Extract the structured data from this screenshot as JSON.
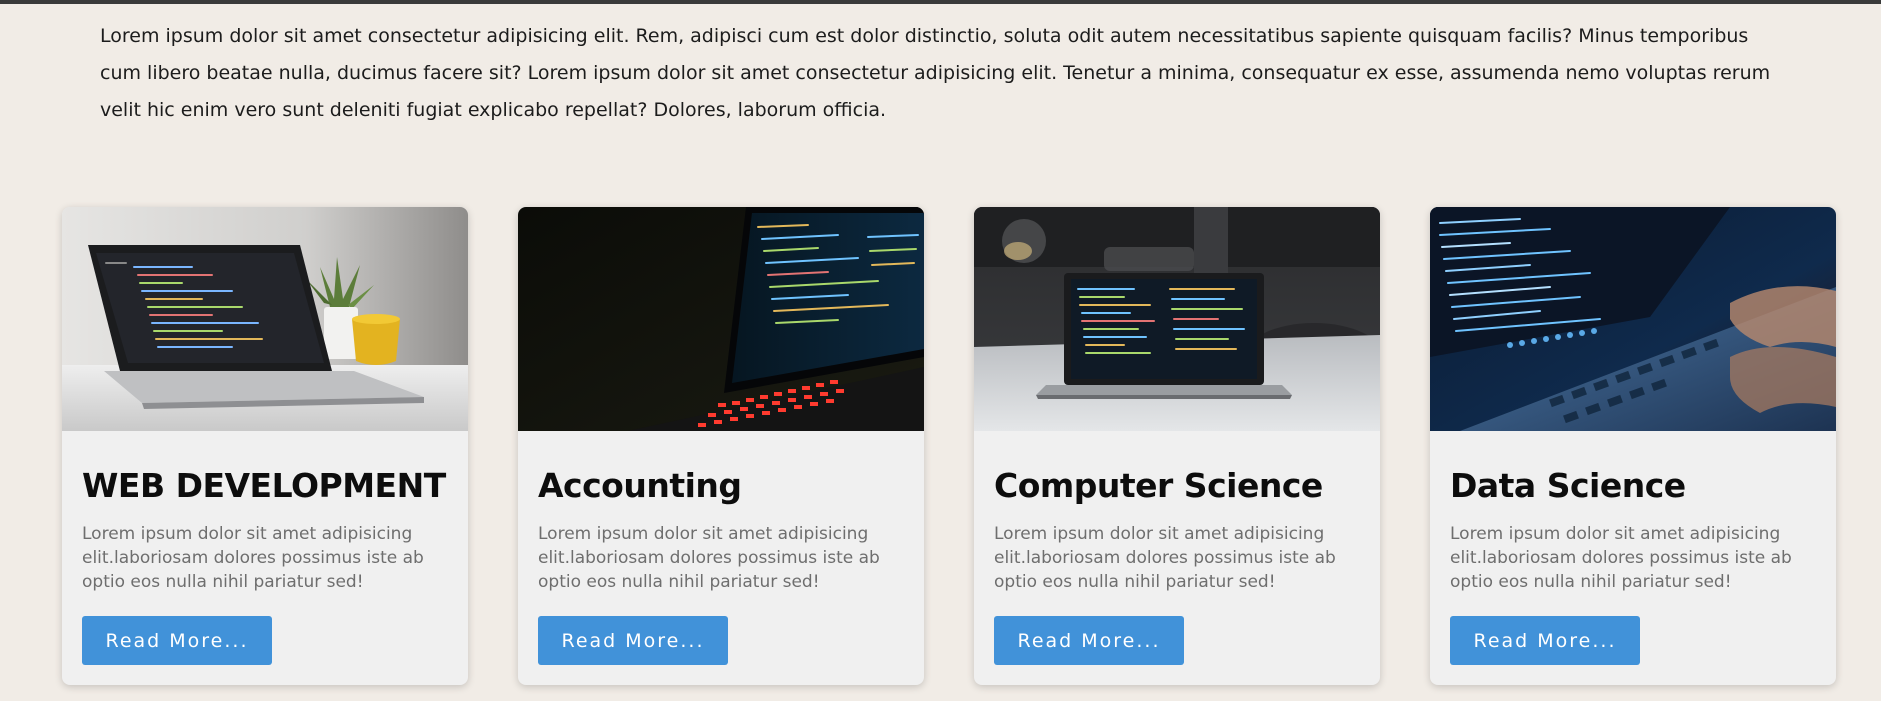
{
  "intro": {
    "text": "Lorem ipsum dolor sit amet consectetur adipisicing elit. Rem, adipisci cum est dolor distinctio, soluta odit autem necessitatibus sapiente quisquam facilis? Minus temporibus cum libero beatae nulla, ducimus facere sit? Lorem ipsum dolor sit amet consectetur adipisicing elit. Tenetur a minima, consequatur ex esse, assumenda nemo voluptas rerum velit hic enim vero sunt deleniti fugiat explicabo repellat? Dolores, laborum officia."
  },
  "cards": [
    {
      "title": "WEB DEVELOPMENT",
      "text": "Lorem ipsum dolor sit amet adipisicing elit.laboriosam dolores possimus iste ab optio eos nulla nihil pariatur sed!",
      "button": "Read More...",
      "image": "laptop-code-white-desk-photo"
    },
    {
      "title": "Accounting",
      "text": "Lorem ipsum dolor sit amet adipisicing elit.laboriosam dolores possimus iste ab optio eos nulla nihil pariatur sed!",
      "button": "Read More...",
      "image": "laptop-red-keyboard-dark-photo"
    },
    {
      "title": "Computer Science",
      "text": "Lorem ipsum dolor sit amet adipisicing elit.laboriosam dolores possimus iste ab optio eos nulla nihil pariatur sed!",
      "button": "Read More...",
      "image": "laptop-on-table-photo"
    },
    {
      "title": "Data Science",
      "text": "Lorem ipsum dolor sit amet adipisicing elit.laboriosam dolores possimus iste ab optio eos nulla nihil pariatur sed!",
      "button": "Read More...",
      "image": "hands-typing-laptop-photo"
    }
  ],
  "colors": {
    "page_background": "#f1ece6",
    "card_background": "#f0f0f0",
    "button": "#4192d9",
    "title": "#0d0d0d",
    "body_text": "#6e6e6e"
  }
}
